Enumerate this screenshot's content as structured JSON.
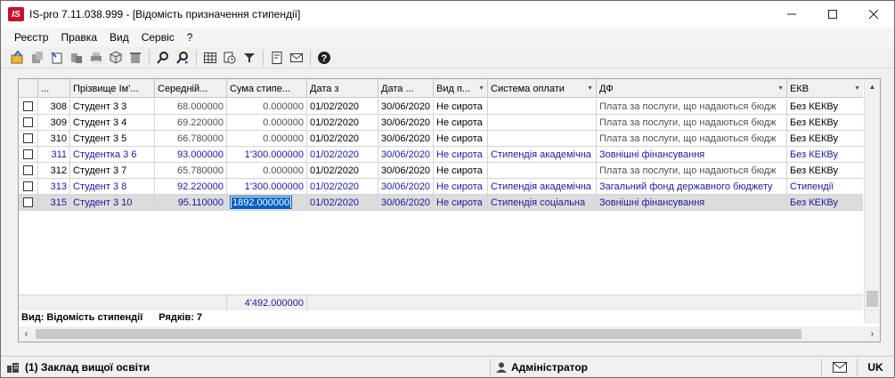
{
  "window": {
    "logo_text": "IS",
    "title": "IS-pro 7.11.038.999 - [Відомість призначення стипендії]"
  },
  "menu": [
    "Реєстр",
    "Правка",
    "Вид",
    "Сервіс",
    "?"
  ],
  "toolbar": {
    "buttons": [
      "open-icon",
      "copy-icon",
      "new-doc-icon",
      "paste-icon",
      "print-icon",
      "package-icon",
      "delete-icon",
      "search-icon",
      "search-next-icon",
      "table-icon",
      "clock-icon",
      "filter-icon",
      "document-icon",
      "mail-icon",
      "help-icon"
    ]
  },
  "grid": {
    "columns": [
      "...",
      "Прізвище Ім'...",
      "Середній...",
      "Сума стипе...",
      "Дата з",
      "Дата ...",
      "Вид п...",
      "Система оплати",
      "ДФ",
      "ЕКВ"
    ],
    "rows": [
      {
        "num": "308",
        "name": "Студент 3 3",
        "avg": "68.000000",
        "sum": "0.000000",
        "date_from": "01/02/2020",
        "date_to": "30/06/2020",
        "kind": "Не сирота",
        "payment": "",
        "df": "Плата за послуги, що надаються бюдж",
        "ekv": "Без КЕКВу",
        "style": "gray"
      },
      {
        "num": "309",
        "name": "Студент 3 4",
        "avg": "69.220000",
        "sum": "0.000000",
        "date_from": "01/02/2020",
        "date_to": "30/06/2020",
        "kind": "Не сирота",
        "payment": "",
        "df": "Плата за послуги, що надаються бюдж",
        "ekv": "Без КЕКВу",
        "style": "gray"
      },
      {
        "num": "310",
        "name": "Студент 3 5",
        "avg": "66.780000",
        "sum": "0.000000",
        "date_from": "01/02/2020",
        "date_to": "30/06/2020",
        "kind": "Не сирота",
        "payment": "",
        "df": "Плата за послуги, що надаються бюдж",
        "ekv": "Без КЕКВу",
        "style": "gray"
      },
      {
        "num": "311",
        "name": "Студентка 3 6",
        "avg": "93.000000",
        "sum": "1'300.000000",
        "date_from": "01/02/2020",
        "date_to": "30/06/2020",
        "kind": "Не сирота",
        "payment": "Стипендія академічна",
        "df": "Зовнішні фінансування",
        "ekv": "Без КЕКВу",
        "style": "blue"
      },
      {
        "num": "312",
        "name": "Студент 3 7",
        "avg": "65.780000",
        "sum": "0.000000",
        "date_from": "01/02/2020",
        "date_to": "30/06/2020",
        "kind": "Не сирота",
        "payment": "",
        "df": "Плата за послуги, що надаються бюдж",
        "ekv": "Без КЕКВу",
        "style": "gray"
      },
      {
        "num": "313",
        "name": "Студент 3 8",
        "avg": "92.220000",
        "sum": "1'300.000000",
        "date_from": "01/02/2020",
        "date_to": "30/06/2020",
        "kind": "Не сирота",
        "payment": "Стипендія академічна",
        "df": "Загальний фонд державного бюджету",
        "ekv": "Стипендії",
        "style": "blue"
      },
      {
        "num": "315",
        "name": "Студент 3 10",
        "avg": "95.110000",
        "sum": "1892.000000",
        "date_from": "01/02/2020",
        "date_to": "30/06/2020",
        "kind": "Не сирота",
        "payment": "Стипендія соціальна",
        "df": "Зовнішні фінансування",
        "ekv": "Без КЕКВу",
        "style": "blue selected"
      }
    ],
    "total_sum": "4'492.000000",
    "view_label": "Вид: Відомість стипендії",
    "rows_label": "Рядків: 7"
  },
  "statusbar": {
    "org": "(1) Заклад вищої освіти",
    "user": "Адміністратор",
    "lang": "UK"
  },
  "colors": {
    "blue_text": "#1a1aa0",
    "selection": "#0060c0",
    "logo": "#c8102e"
  }
}
